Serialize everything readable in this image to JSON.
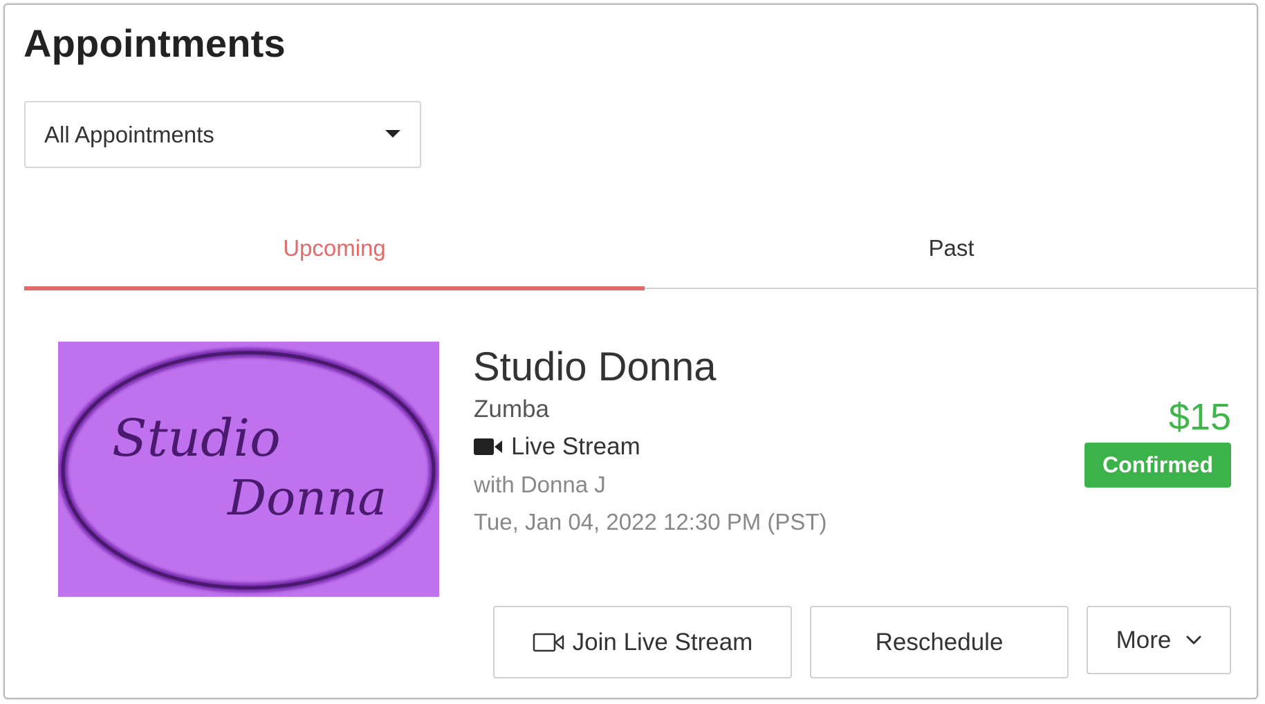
{
  "header": {
    "title": "Appointments"
  },
  "filter": {
    "selected": "All Appointments"
  },
  "tabs": [
    {
      "label": "Upcoming",
      "active": true
    },
    {
      "label": "Past",
      "active": false
    }
  ],
  "appointment": {
    "logo_text_line1": "Studio",
    "logo_text_line2": "Donna",
    "studio_name": "Studio Donna",
    "activity": "Zumba",
    "mode_icon": "video-camera-icon",
    "mode_label": "Live Stream",
    "instructor": "with Donna J",
    "datetime": "Tue, Jan 04, 2022 12:30 PM (PST)",
    "price": "$15",
    "status": "Confirmed"
  },
  "actions": {
    "join_label": "Join Live Stream",
    "reschedule_label": "Reschedule",
    "more_label": "More"
  },
  "colors": {
    "accent_tab": "#e46a6a",
    "price_green": "#3fb54a",
    "badge_green": "#3cb34a",
    "logo_bg": "#c072ee",
    "logo_ring": "#4a1a6e"
  }
}
